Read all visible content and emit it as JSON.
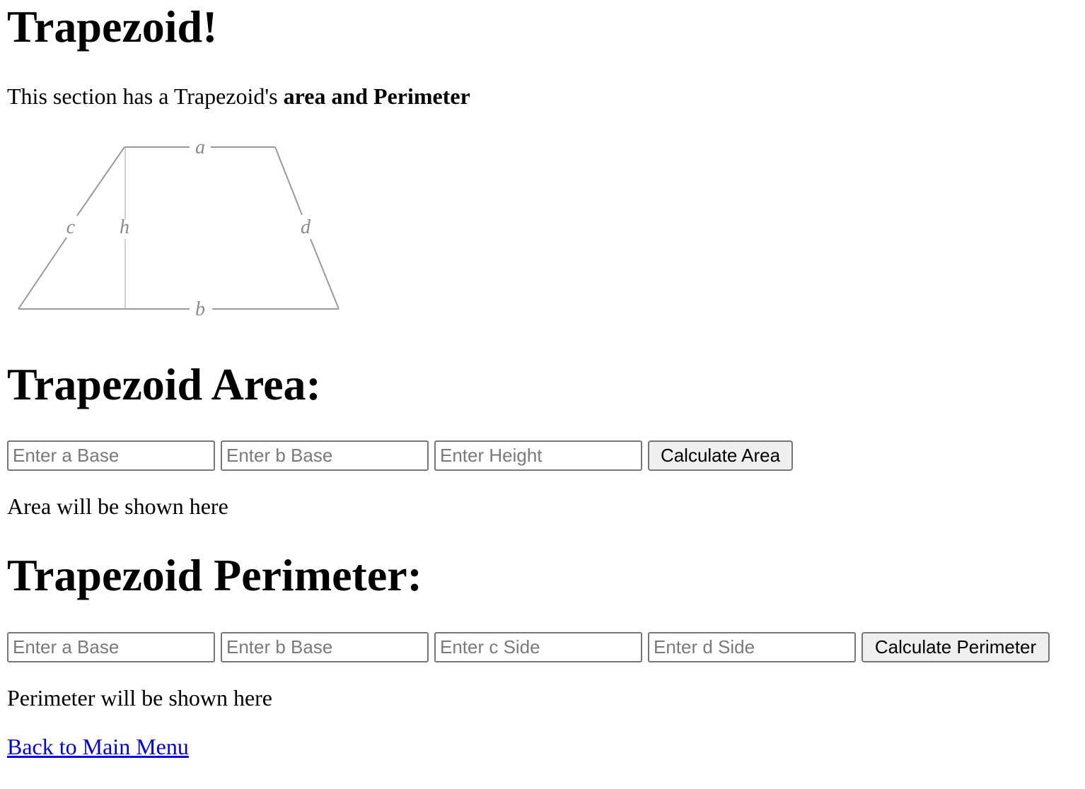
{
  "page": {
    "title": "Trapezoid!",
    "intro_prefix": "This section has a Trapezoid's ",
    "intro_bold": "area and Perimeter"
  },
  "diagram": {
    "labels": {
      "a": "a",
      "b": "b",
      "c": "c",
      "d": "d",
      "h": "h"
    },
    "line_color": "#9a9a9a",
    "height_line_color": "#d0d0d0"
  },
  "area": {
    "heading": "Trapezoid Area:",
    "inputs": [
      {
        "placeholder": "Enter a Base",
        "value": ""
      },
      {
        "placeholder": "Enter b Base",
        "value": ""
      },
      {
        "placeholder": "Enter Height",
        "value": ""
      }
    ],
    "button_label": "Calculate Area",
    "result_text": "Area will be shown here"
  },
  "perimeter": {
    "heading": "Trapezoid Perimeter:",
    "inputs": [
      {
        "placeholder": "Enter a Base",
        "value": ""
      },
      {
        "placeholder": "Enter b Base",
        "value": ""
      },
      {
        "placeholder": "Enter c Side",
        "value": ""
      },
      {
        "placeholder": "Enter d Side",
        "value": ""
      }
    ],
    "button_label": "Calculate Perimeter",
    "result_text": "Perimeter will be shown here"
  },
  "nav": {
    "back_link": "Back to Main Menu"
  },
  "colors": {
    "link": "#0000ee",
    "button_bg": "#efefef",
    "input_border": "#767676",
    "placeholder": "#7a7a7a"
  }
}
